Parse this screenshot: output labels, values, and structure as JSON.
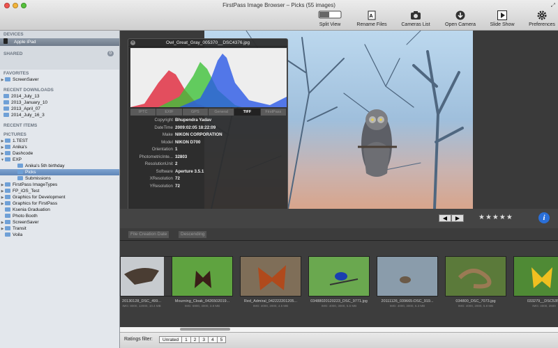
{
  "window": {
    "title": "FirstPass Image Browser – Picks (55 images)"
  },
  "toolbar": [
    {
      "label": "Split View",
      "icon": "split-view-icon"
    },
    {
      "label": "Rename Files",
      "icon": "rename-files-icon"
    },
    {
      "label": "Cameras List",
      "icon": "camera-icon"
    },
    {
      "label": "Open Camera",
      "icon": "download-icon"
    },
    {
      "label": "Slide Show",
      "icon": "play-icon"
    },
    {
      "label": "Preferences",
      "icon": "gear-icon"
    }
  ],
  "sidebar": {
    "devices_header": "DEVICES",
    "device": "Apple iPad",
    "shared_header": "SHARED",
    "shared_count": "0",
    "favorites_header": "FAVORITES",
    "favorites": [
      "ScreenSaver"
    ],
    "recent_downloads_header": "RECENT DOWNLOADS",
    "recent_downloads": [
      "2014_July_13",
      "2013_January_10",
      "2013_April_07",
      "2014_July_16_3"
    ],
    "recent_items_header": "RECENT ITEMS",
    "pictures_header": "PICTURES",
    "pictures": [
      {
        "label": "1.TEST",
        "level": 0,
        "tri": "▶"
      },
      {
        "label": "Anika's",
        "level": 0,
        "tri": "▶"
      },
      {
        "label": "Dashcode",
        "level": 0,
        "tri": "▶"
      },
      {
        "label": "EXP",
        "level": 0,
        "tri": "▼"
      },
      {
        "label": "Anika's 5th birthday",
        "level": 1,
        "tri": ""
      },
      {
        "label": "Picks",
        "level": 1,
        "tri": "",
        "selected": true
      },
      {
        "label": "Submissions",
        "level": 1,
        "tri": ""
      },
      {
        "label": "FirstPass ImageTypes",
        "level": 0,
        "tri": "▶"
      },
      {
        "label": "FP_iOS_Test",
        "level": 0,
        "tri": "▶"
      },
      {
        "label": "Graphics for Development",
        "level": 0,
        "tri": "▶"
      },
      {
        "label": "Graphics for FirstPass",
        "level": 0,
        "tri": "▶"
      },
      {
        "label": "Ksenia Graduation",
        "level": 0,
        "tri": ""
      },
      {
        "label": "Photo Booth",
        "level": 0,
        "tri": ""
      },
      {
        "label": "ScreenSaver",
        "level": 0,
        "tri": "▶"
      },
      {
        "label": "Transit",
        "level": 0,
        "tri": "▶"
      },
      {
        "label": "Voila",
        "level": 0,
        "tri": ""
      }
    ]
  },
  "inspector": {
    "filename": "Owl_Great_Gray_005370__DSC4376.jpg",
    "tabs": [
      "IPTC",
      "EXIF",
      "GPS",
      "General",
      "TIFF",
      "FirstPass"
    ],
    "active_tab": "TIFF",
    "fields": [
      {
        "key": "Copyright",
        "value": "Bhupendra Yadav"
      },
      {
        "key": "DateTime",
        "value": "2009:02:05 18:22:09"
      },
      {
        "key": "Make",
        "value": "NIKON CORPORATION"
      },
      {
        "key": "Model",
        "value": "NIKON D700"
      },
      {
        "key": "Orientation",
        "value": "1"
      },
      {
        "key": "PhotometricInte...",
        "value": "32803"
      },
      {
        "key": "ResolutionUnit",
        "value": "2"
      },
      {
        "key": "Software",
        "value": "Aperture 3.5.1"
      },
      {
        "key": "XResolution",
        "value": "72"
      },
      {
        "key": "YResolution",
        "value": "72"
      }
    ]
  },
  "sort": {
    "field": "File Creation Date",
    "order": "Descending"
  },
  "rating_display": "★★★★★",
  "info_button": "i",
  "filmstrip": [
    {
      "name": "20130128_DSC_499...",
      "sub": "IMG: 8000, 12000, 10.4 MB"
    },
    {
      "name": "Mourning_Cloak_0426502019...",
      "sub": "IMG: 6900, 4000, 3.8 MB"
    },
    {
      "name": "Red_Admiral_042222201205...",
      "sub": "IMG: 4000, 2000, 4.5 MB"
    },
    {
      "name": "03488020120223_DSC_9771.jpg",
      "sub": "IMG: 4000, 3000, 5.5 MB"
    },
    {
      "name": "20111126_039665-DSC_919...",
      "sub": "IMG: 4000, 3000, 6.3 MB"
    },
    {
      "name": "034800_DSC_7073.jpg",
      "sub": "IMG: 4000, 2000, 5.8 MB"
    },
    {
      "name": "033279__DSC5355",
      "sub": "IMG: 4000, 2600"
    }
  ],
  "ratings_filter": {
    "label": "Ratings filter:",
    "options": [
      "Unrated",
      "1",
      "2",
      "3",
      "4",
      "5"
    ]
  },
  "colors": {
    "histogram_red": "#e0263a",
    "histogram_green": "#3fc23a",
    "histogram_blue": "#2b59e6",
    "selection": "#5f86b8",
    "accent_info": "#2a6fd8"
  }
}
